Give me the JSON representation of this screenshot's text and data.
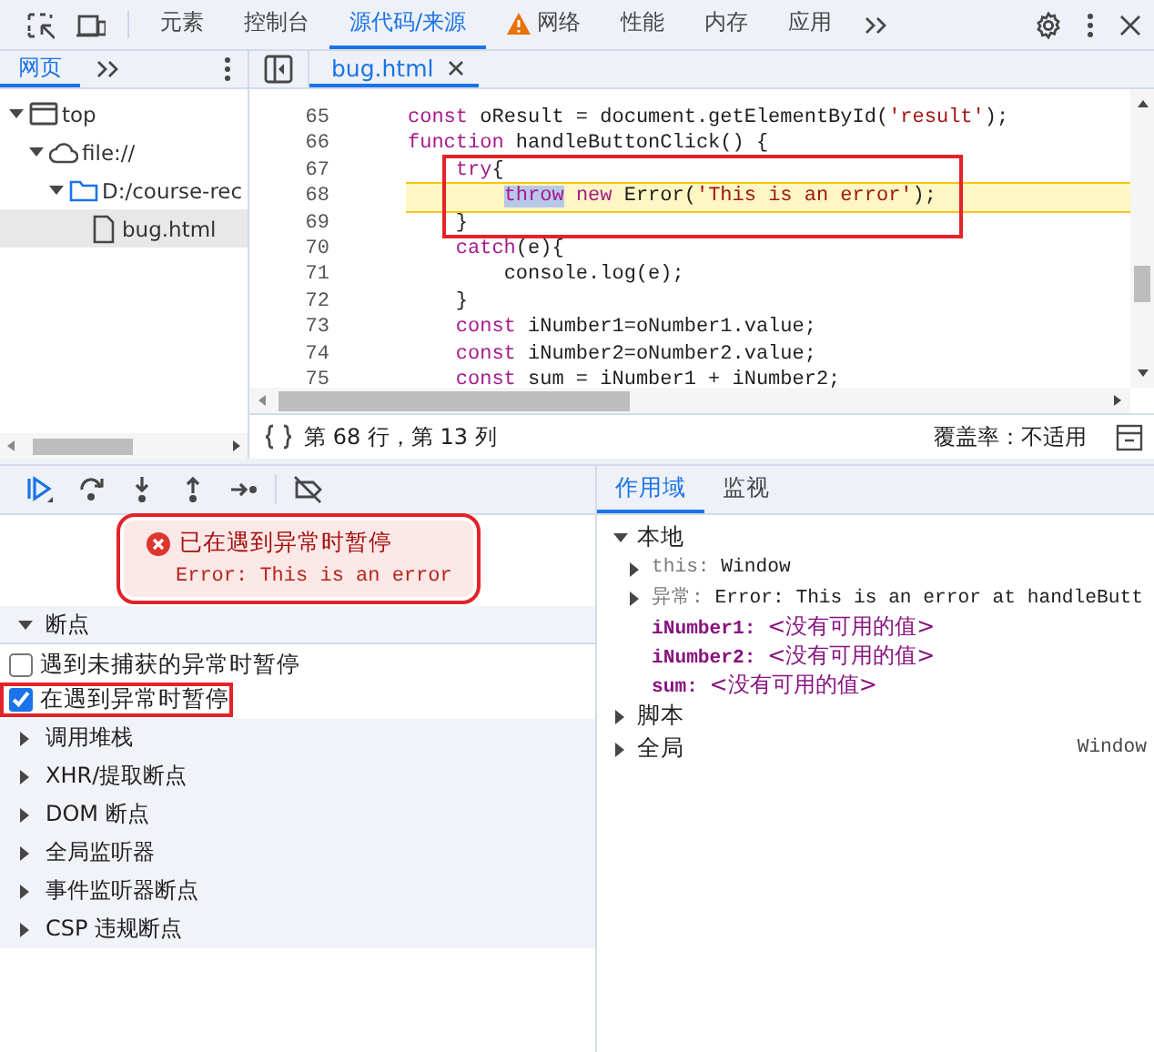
{
  "toolbar": {
    "tabs": [
      {
        "label": "元素",
        "selected": false,
        "warning": false
      },
      {
        "label": "控制台",
        "selected": false,
        "warning": false
      },
      {
        "label": "源代码/来源",
        "selected": true,
        "warning": false
      },
      {
        "label": "网络",
        "selected": false,
        "warning": true
      },
      {
        "label": "性能",
        "selected": false,
        "warning": false
      },
      {
        "label": "内存",
        "selected": false,
        "warning": false
      },
      {
        "label": "应用",
        "selected": false,
        "warning": false
      }
    ]
  },
  "navigator": {
    "tabs": [
      {
        "label": "网页",
        "selected": true
      }
    ],
    "tree": [
      {
        "label": "top",
        "kind": "frame",
        "expanded": true,
        "selected": false,
        "children": [
          {
            "label": "file://",
            "kind": "cloud",
            "expanded": true,
            "selected": false,
            "children": [
              {
                "label": "D:/course-rec",
                "kind": "folder",
                "expanded": true,
                "selected": false,
                "children": [
                  {
                    "label": "bug.html",
                    "kind": "file",
                    "selected": true
                  }
                ]
              }
            ]
          }
        ]
      }
    ]
  },
  "editor": {
    "tabs": [
      {
        "label": "bug.html",
        "selected": true
      }
    ],
    "lines": [
      {
        "number": "65",
        "paused": false,
        "boxed": false,
        "tokens": [
          {
            "kind": "keyword",
            "text": "const"
          },
          {
            "kind": "plain",
            "text": " oResult = document.getElementById("
          },
          {
            "kind": "string",
            "text": "'result'"
          },
          {
            "kind": "plain",
            "text": ");"
          }
        ]
      },
      {
        "number": "66",
        "paused": false,
        "boxed": false,
        "tokens": [
          {
            "kind": "keyword",
            "text": "function"
          },
          {
            "kind": "plain",
            "text": " handleButtonClick() {"
          }
        ]
      },
      {
        "number": "67",
        "paused": false,
        "boxed": true,
        "tokens": [
          {
            "kind": "keyword",
            "text": "    try"
          },
          {
            "kind": "plain",
            "text": "{"
          }
        ]
      },
      {
        "number": "68",
        "paused": true,
        "boxed": true,
        "tokens": [
          {
            "kind": "selected",
            "text": "        throw"
          },
          {
            "kind": "keyword",
            "text": " new"
          },
          {
            "kind": "plain",
            "text": " Error("
          },
          {
            "kind": "string",
            "text": "'This is an error'"
          },
          {
            "kind": "plain",
            "text": ");"
          }
        ]
      },
      {
        "number": "69",
        "paused": false,
        "boxed": true,
        "tokens": [
          {
            "kind": "plain",
            "text": "    }"
          }
        ]
      },
      {
        "number": "70",
        "paused": false,
        "boxed": false,
        "tokens": [
          {
            "kind": "keyword",
            "text": "    catch"
          },
          {
            "kind": "plain",
            "text": "(e){"
          }
        ]
      },
      {
        "number": "71",
        "paused": false,
        "boxed": false,
        "tokens": [
          {
            "kind": "plain",
            "text": "        console.log(e);"
          }
        ]
      },
      {
        "number": "72",
        "paused": false,
        "boxed": false,
        "tokens": [
          {
            "kind": "plain",
            "text": "    }"
          }
        ]
      },
      {
        "number": "73",
        "paused": false,
        "boxed": false,
        "tokens": [
          {
            "kind": "keyword",
            "text": "    const"
          },
          {
            "kind": "plain",
            "text": " iNumber1=oNumber1.value;"
          }
        ]
      },
      {
        "number": "74",
        "paused": false,
        "boxed": false,
        "tokens": [
          {
            "kind": "keyword",
            "text": "    const"
          },
          {
            "kind": "plain",
            "text": " iNumber2=oNumber2.value;"
          }
        ]
      },
      {
        "number": "75",
        "paused": false,
        "boxed": false,
        "tokens": [
          {
            "kind": "keyword",
            "text": "    const"
          },
          {
            "kind": "plain",
            "text": " sum = iNumber1 + iNumber2;"
          }
        ]
      }
    ],
    "status": {
      "position": "第 68 行，第 13 列",
      "coverage": "覆盖率：不适用"
    }
  },
  "debugger": {
    "paused": {
      "title": "已在遇到异常时暂停",
      "message": "Error: This is an error",
      "boxed": true
    },
    "sections": [
      {
        "label": "断点",
        "expanded": true,
        "options": [
          {
            "label": "遇到未捕获的异常时暂停",
            "checked": false,
            "boxed": false
          },
          {
            "label": "在遇到异常时暂停",
            "checked": true,
            "boxed": true
          }
        ]
      },
      {
        "label": "调用堆栈",
        "expanded": false
      },
      {
        "label": "XHR/提取断点",
        "expanded": false
      },
      {
        "label": "DOM 断点",
        "expanded": false
      },
      {
        "label": "全局监听器",
        "expanded": false
      },
      {
        "label": "事件监听器断点",
        "expanded": false
      },
      {
        "label": "CSP 违规断点",
        "expanded": false
      }
    ]
  },
  "scope": {
    "tabs": [
      {
        "label": "作用域",
        "selected": true
      },
      {
        "label": "监视",
        "selected": false
      }
    ],
    "tree": [
      {
        "kind": "group",
        "name": "本地",
        "expanded": true,
        "children": [
          {
            "kind": "property",
            "name": "this:",
            "value": "Window",
            "expanded": false
          },
          {
            "kind": "property",
            "name": "异常:",
            "value": "Error: This is an error at handleButt",
            "expanded": false
          },
          {
            "kind": "variable",
            "name": "iNumber1:",
            "value": "<没有可用的值>"
          },
          {
            "kind": "variable",
            "name": "iNumber2:",
            "value": "<没有可用的值>"
          },
          {
            "kind": "variable",
            "name": "sum:",
            "value": "<没有可用的值>"
          }
        ]
      },
      {
        "kind": "group",
        "name": "脚本",
        "expanded": false
      },
      {
        "kind": "group",
        "name": "全局",
        "expanded": false,
        "value": "Window"
      }
    ]
  }
}
